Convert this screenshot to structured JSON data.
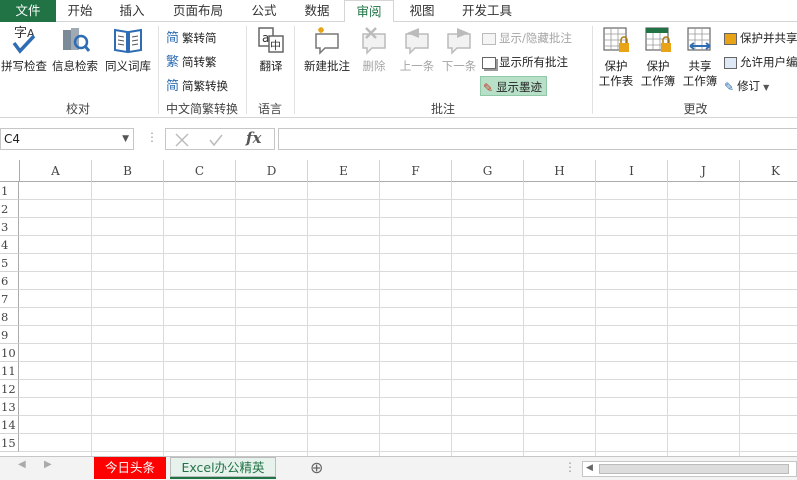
{
  "tabs": [
    {
      "label": "文件"
    },
    {
      "label": "开始"
    },
    {
      "label": "插入"
    },
    {
      "label": "页面布局"
    },
    {
      "label": "公式"
    },
    {
      "label": "数据"
    },
    {
      "label": "审阅"
    },
    {
      "label": "视图"
    },
    {
      "label": "开发工具"
    }
  ],
  "colors": {
    "excel_green": "#217346",
    "highlight": "#b8e0c8",
    "red_tab": "#ff0000",
    "green_tab": "#e8f2ec"
  },
  "ribbon": {
    "proofing": {
      "spell": "拼写检查",
      "research": "信息检索",
      "thesaurus": "同义词库",
      "group": "校对"
    },
    "chinese": {
      "t2s": "繁转简",
      "s2t": "简转繁",
      "convert": "简繁转换",
      "group": "中文简繁转换"
    },
    "language": {
      "translate": "翻译",
      "group": "语言"
    },
    "comments": {
      "new": "新建批注",
      "delete": "删除",
      "prev": "上一条",
      "next": "下一条",
      "show_hide": "显示/隐藏批注",
      "show_all": "显示所有批注",
      "show_ink": "显示墨迹",
      "group": "批注"
    },
    "changes": {
      "protect_sheet_1": "保护",
      "protect_sheet_2": "工作表",
      "protect_wb_1": "保护",
      "protect_wb_2": "工作簿",
      "share_1": "共享",
      "share_2": "工作簿",
      "protect_share": "保护并共享",
      "allow_edit": "允许用户编",
      "track": "修订",
      "group": "更改"
    }
  },
  "namebox": {
    "value": "C4"
  },
  "fx_label": "fx",
  "columns": [
    "A",
    "B",
    "C",
    "D",
    "E",
    "F",
    "G",
    "H",
    "I",
    "J",
    "K"
  ],
  "rows": [
    "1",
    "2",
    "3",
    "4",
    "5",
    "6",
    "7",
    "8",
    "9",
    "10",
    "11",
    "12",
    "13",
    "14",
    "15"
  ],
  "sheets": [
    {
      "label": "今日头条"
    },
    {
      "label": "Excel办公精英"
    }
  ],
  "add_sheet": "⊕"
}
